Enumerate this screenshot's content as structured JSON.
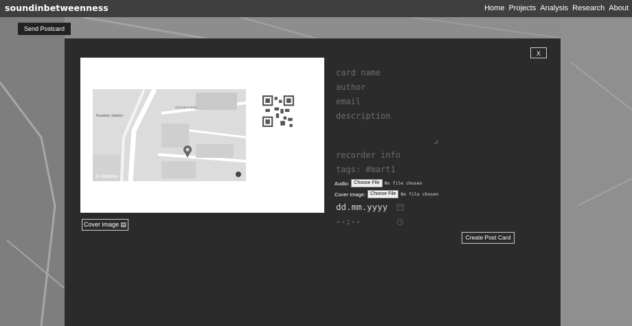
{
  "header": {
    "brand": "soundinbetweenness",
    "nav": [
      "Home",
      "Projects",
      "Analysis",
      "Research",
      "About"
    ]
  },
  "toolbar": {
    "send_label": "Send Postcard"
  },
  "modal": {
    "close_label": "X",
    "map_labels": {
      "station": "Karaköy Station",
      "street": "Gümrük Sokağı",
      "attribution": "© mapbox"
    },
    "cover_label": "Cover image",
    "fields": {
      "card_name": "card name",
      "author": "author",
      "email": "email",
      "description": "description",
      "recorder": "recorder info",
      "tags": "tags:  #mart1"
    },
    "audio_label": "Audio:",
    "cover_file_label": "Cover Image:",
    "choose_file": "Choose File",
    "no_file": "No file chosen",
    "date_placeholder": "dd.mm.yyyy",
    "time_placeholder": "--:--",
    "create_label": "Create Post Card"
  },
  "colors": {
    "topbar": "#3f3f3f",
    "modal": "#2b2b2b",
    "placeholder": "#6c6c6c"
  }
}
